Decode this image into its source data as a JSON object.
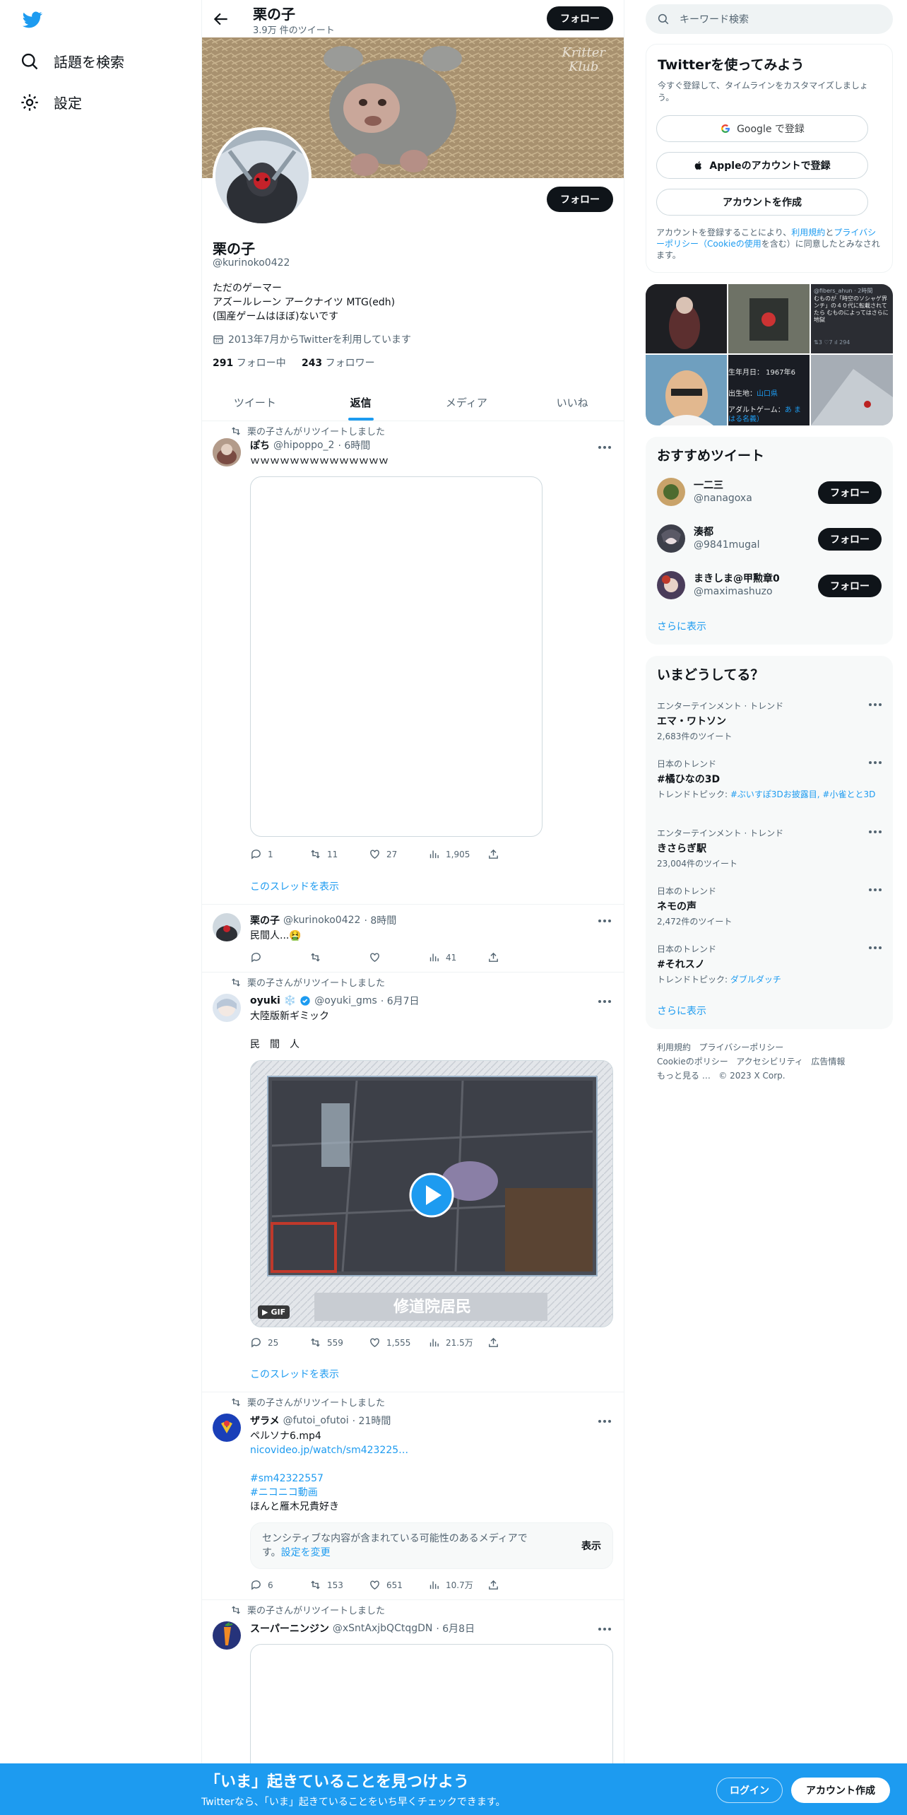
{
  "nav": {
    "search_label": "話題を検索",
    "settings_label": "設定"
  },
  "header": {
    "title": "栗の子",
    "tweet_count": "3.9万 件のツイート",
    "follow_label": "フォロー"
  },
  "banner": {
    "watermark_line1": "Kritter",
    "watermark_line2": "Klub"
  },
  "profile": {
    "name": "栗の子",
    "handle": "@kurinoko0422",
    "bio_line1": "ただのゲーマー",
    "bio_line2": "アズールレーン アークナイツ  MTG(edh)",
    "bio_line3": "(国産ゲームはほぼ)ないです",
    "joined": "2013年7月からTwitterを利用しています",
    "following_count": "291",
    "following_label": "フォロー中",
    "followers_count": "243",
    "followers_label": "フォロワー",
    "follow_label": "フォロー"
  },
  "tabs": [
    "ツイート",
    "返信",
    "メディア",
    "いいね"
  ],
  "tweets": {
    "t1": {
      "rt": "栗の子さんがリツイートしました",
      "name": "ぽち",
      "handle": "@hipoppo_2",
      "time": "· 6時間",
      "text": "ｗｗｗｗｗｗｗｗｗｗｗｗｗｗ",
      "reply": "1",
      "retweet": "11",
      "like": "27",
      "views": "1,905",
      "thread": "このスレッドを表示"
    },
    "t2": {
      "name": "栗の子",
      "handle": "@kurinoko0422",
      "time": "· 8時間",
      "text": "民間人...🤮",
      "reply": "",
      "retweet": "",
      "like": "",
      "views": "41"
    },
    "t3": {
      "rt": "栗の子さんがリツイートしました",
      "name": "oyuki",
      "name_emoji": "❄️",
      "handle": "@oyuki_gms",
      "time": "· 6月7日",
      "text1": "大陸版新ギミック",
      "text2": "民　間　人",
      "gif_caption": "修道院居民",
      "gif_badge": "GIF",
      "reply": "25",
      "retweet": "559",
      "like": "1,555",
      "views": "21.5万",
      "thread": "このスレッドを表示"
    },
    "t4": {
      "rt": "栗の子さんがリツイートしました",
      "name": "ザラメ",
      "handle": "@futoi_ofutoi",
      "time": "· 21時間",
      "text1": "ペルソナ6.mp4",
      "link": "nicovideo.jp/watch/sm423225…",
      "tag1": "#sm42322557",
      "tag2": "#ニコニコ動画",
      "text2": "ほんと雁木兄貴好き",
      "sensitive": "センシティブな内容が含まれている可能性のあるメディアです。",
      "sensitive_link": "設定を変更",
      "show": "表示",
      "reply": "6",
      "retweet": "153",
      "like": "651",
      "views": "10.7万"
    },
    "t5": {
      "rt": "栗の子さんがリツイートしました",
      "name": "スーパーニンジン",
      "handle": "@xSntAxjbQCtqgDN",
      "time": "· 6月8日"
    }
  },
  "search": {
    "placeholder": "キーワード検索"
  },
  "signup": {
    "title": "Twitterを使ってみよう",
    "subtitle": "今すぐ登録して、タイムラインをカスタマイズしましょう。",
    "google": "Google で登録",
    "apple": "Appleのアカウントで登録",
    "create": "アカウントを作成",
    "legal_pre": "アカウントを登録することにより、",
    "legal_terms": "利用規約",
    "legal_and": "と",
    "legal_privacy": "プライバシーポリシー（Cookieの使用",
    "legal_post": "を含む）に同意したとみなされます。"
  },
  "media_grid": {
    "overlay_user": "@fibers_ahun · 2時間",
    "overlay_text": "むものが「時空のソシャゲ界ンチ」の４０代に転載されてたら むものによってはさらに地獄",
    "overlay_stats": "⇅3  ♡7  ıl 294",
    "profile_birth": "生年月日：  1967年6",
    "profile_place_label": "出生地：",
    "profile_place": "山口県",
    "profile_adult_label": "アダルトゲーム：",
    "profile_adult": "あ まはる名義）"
  },
  "suggest": {
    "title": "おすすめツイート",
    "follow_label": "フォロー",
    "users": [
      {
        "name": "一二三",
        "handle": "@nanagoxa"
      },
      {
        "name": "湊都",
        "handle": "@9841mugal"
      },
      {
        "name": "まきしま@甲勲章0",
        "handle": "@maximashuzo"
      }
    ],
    "more": "さらに表示"
  },
  "trends": {
    "title": "いまどうしてる？",
    "items": [
      {
        "cat": "エンターテインメント · トレンド",
        "title": "エマ・ワトソン",
        "count": "2,683件のツイート"
      },
      {
        "cat": "日本のトレンド",
        "title": "#橘ひなの3D",
        "count_pre": "トレンドトピック: ",
        "count_link": "#ぶいすぽ3Dお披露目, #小雀とと3D"
      },
      {
        "cat": "エンターテインメント · トレンド",
        "title": "きさらぎ駅",
        "count": "23,004件のツイート"
      },
      {
        "cat": "日本のトレンド",
        "title": "ネモの声",
        "count": "2,472件のツイート"
      },
      {
        "cat": "日本のトレンド",
        "title": "#それスノ",
        "count_pre": "トレンドトピック: ",
        "count_link": "ダブルダッチ"
      }
    ],
    "more": "さらに表示"
  },
  "footer": {
    "terms": "利用規約",
    "privacy": "プライバシーポリシー",
    "cookie": "Cookieのポリシー",
    "access": "アクセシビリティ",
    "ads": "広告情報",
    "more": "もっと見る …",
    "copy": "© 2023 X Corp."
  },
  "bottom": {
    "title": "「いま」起きていることを見つけよう",
    "subtitle": "Twitterなら、「いま」起きていることをいち早くチェックできます。",
    "login": "ログイン",
    "signup": "アカウント作成"
  },
  "colors": {
    "accent": "#1d9bf0",
    "text": "#0f1419",
    "muted": "#536471"
  }
}
